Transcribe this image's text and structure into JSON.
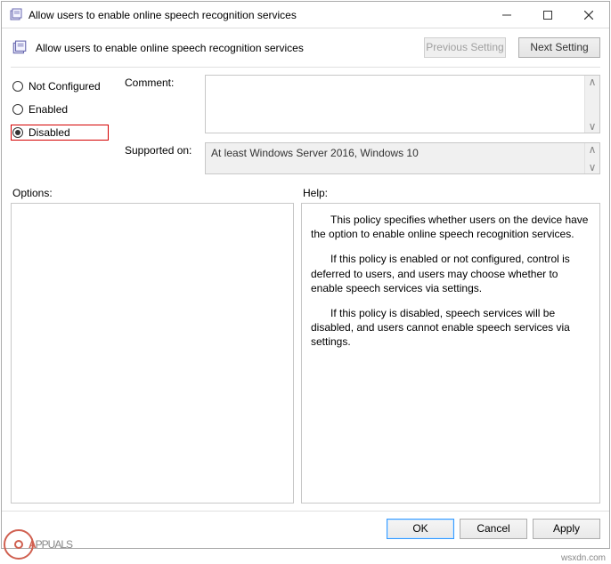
{
  "titlebar": {
    "title": "Allow users to enable online speech recognition services"
  },
  "header": {
    "title": "Allow users to enable online speech recognition services",
    "previous": "Previous Setting",
    "next": "Next Setting"
  },
  "radios": {
    "not_configured": "Not Configured",
    "enabled": "Enabled",
    "disabled": "Disabled",
    "selected": "disabled"
  },
  "fields": {
    "comment_label": "Comment:",
    "comment_value": "",
    "supported_label": "Supported on:",
    "supported_value": "At least Windows Server 2016, Windows 10"
  },
  "labels": {
    "options": "Options:",
    "help": "Help:"
  },
  "help": {
    "p1": "This policy specifies whether users on the device have the option to enable online speech recognition services.",
    "p2": "If this policy is enabled or not configured, control is deferred to users, and users may choose whether to enable speech services via settings.",
    "p3": "If this policy is disabled, speech services will be disabled, and users cannot enable speech services via settings."
  },
  "footer": {
    "ok": "OK",
    "cancel": "Cancel",
    "apply": "Apply"
  },
  "watermark": {
    "text_upper": "PPUALS",
    "credit": "wsxdn.com"
  }
}
